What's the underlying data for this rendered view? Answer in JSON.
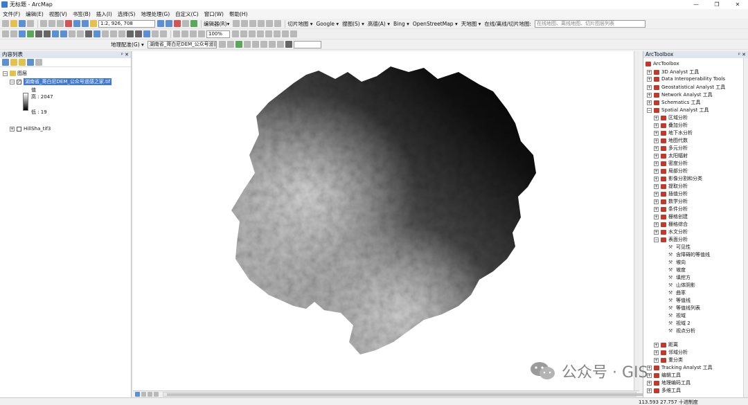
{
  "window": {
    "title": "无标题 - ArcMap",
    "controls": [
      "—",
      "❐",
      "✕"
    ]
  },
  "menu": [
    "文件(F)",
    "编辑(E)",
    "视图(V)",
    "书签(B)",
    "插入(I)",
    "选择(S)",
    "地理处理(G)",
    "自定义(C)",
    "窗口(W)",
    "帮助(H)"
  ],
  "toolbar1": {
    "scale": "1:2, 926, 708",
    "editor": "编辑器(R)▾",
    "tile_map": "切片地图 ▾",
    "google": "Google ▾",
    "search": "搜图(S) ▾",
    "gaode": "高德(A) ▾",
    "bing": "Bing ▾",
    "osm": "OpenStreetMap ▾",
    "tianditu": "天地图 ▾",
    "online_label": "在线/离线/切片地图:",
    "online_placeholder": "在线地图、离线地图、切片图层列表"
  },
  "toolbar2": {
    "zoom": "100%"
  },
  "toolbar3": {
    "georef": "地理配准(G) ▾",
    "layer": "湖南省_哥白尼DEM_公众号遥感 ▾"
  },
  "toc": {
    "title": "内容列表",
    "header_buttons": "ᵖ ✕",
    "layers_group": "图层",
    "dem_layer": "湖南省_哥白尼DEM_公众号遥感之家.tif",
    "value_label": "值",
    "high": "高 : 2047",
    "low": "低 : 19",
    "hillshade_layer": "HillSha_tif3"
  },
  "toolbox": {
    "title": "ArcToolbox",
    "header_buttons": "ᵖ ✕",
    "root": "ArcToolbox",
    "top_items": [
      "3D Analyst 工具",
      "Data Interoperability Tools",
      "Geostatistical Analyst 工具",
      "Network Analyst 工具",
      "Schematics 工具",
      "Spatial Analyst 工具"
    ],
    "spatial_items": [
      "区域分析",
      "叠加分析",
      "地下水分析",
      "地图代数",
      "多元分析",
      "太阳辐射",
      "密度分析",
      "局部分析",
      "影像分割和分类",
      "提取分析",
      "插值分析",
      "数学分析",
      "条件分析",
      "栅格创建",
      "栅格综合",
      "水文分析",
      "表面分析"
    ],
    "surface_tools": [
      "可见性",
      "含障碍的等值线",
      "坡向",
      "坡度",
      "填挖方",
      "山体阴影",
      "曲率",
      "等值线",
      "等值线列表",
      "视域",
      "视域 2",
      "视点分析"
    ],
    "after_items": [
      "距离",
      "邻域分析",
      "重分类"
    ],
    "bottom_items": [
      "Tracking Analyst 工具",
      "编辑工具",
      "地理编码工具",
      "多维工具"
    ]
  },
  "status": {
    "coords": "113.593  27.757 十进制度"
  },
  "watermark": {
    "text": "公众号 · GIS"
  }
}
